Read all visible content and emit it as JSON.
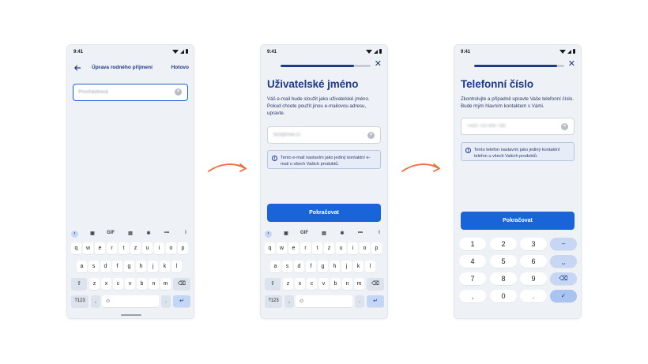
{
  "status_time": "9:41",
  "screen1": {
    "title": "Úprava rodného příjmení",
    "done_label": "Hotovo",
    "input_value": "Procházková",
    "back_icon": "arrow-left-icon",
    "clear_icon": "clear-icon"
  },
  "screen2": {
    "heading": "Uživatelské jméno",
    "description": "Váš e-mail bude sloužit jako uživatelské jméno. Pokud chcete použít jinou e-mailovou adresu, upravte.",
    "email_value": "test@mail.cz",
    "info_text": "Tento e-mail nastavím jako jediný kontaktní e-mail u všech Vašich produktů.",
    "button_label": "Pokračovat",
    "progress": 0.82
  },
  "screen3": {
    "heading": "Telefonní číslo",
    "description": "Zkontrolujte a případně upravte Vaše telefonní číslo. Bude mým hlavním kontaktem s Vámi.",
    "phone_value": "+420 723 405 789",
    "info_text": "Tento telefon nastavím jako jediný kontaktní telefon u všech Vašich produktů.",
    "button_label": "Pokračovat",
    "progress": 0.92
  },
  "keyboard": {
    "tools": [
      "GIF",
      "•••"
    ],
    "row1": [
      "q",
      "w",
      "e",
      "r",
      "t",
      "z",
      "u",
      "i",
      "o",
      "p"
    ],
    "row2": [
      "a",
      "s",
      "d",
      "f",
      "g",
      "h",
      "j",
      "k",
      "l"
    ],
    "row3": [
      "z",
      "x",
      "c",
      "v",
      "b",
      "n",
      "m"
    ],
    "sym_label": "?123",
    "comma": ",",
    "period": ".",
    "emoji": "☺",
    "shift": "⇧",
    "backspace": "⌫",
    "enter": "↵"
  },
  "numpad": {
    "keys": [
      "1",
      "2",
      "3",
      "4",
      "5",
      "6",
      "7",
      "8",
      "9",
      ",",
      "0",
      "."
    ],
    "side": [
      "–",
      "⎵",
      "⌫",
      "✓"
    ]
  },
  "colors": {
    "accent": "#1964d9",
    "heading": "#1e3a8a",
    "arrow": "#f26b3a",
    "background": "#eef1f6"
  }
}
